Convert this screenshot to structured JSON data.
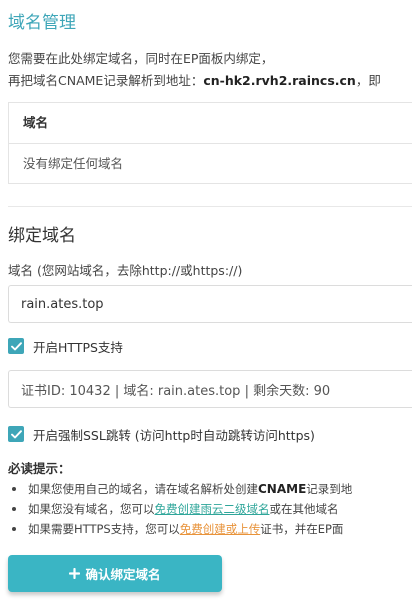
{
  "header": {
    "title": "域名管理",
    "desc_line1": "您需要在此处绑定域名，同时在EP面板内绑定，",
    "desc_line2_prefix": "再把域名CNAME记录解析到地址：",
    "cname_address": "cn-hk2.rvh2.raincs.cn",
    "desc_line2_suffix": "，即"
  },
  "domain_table": {
    "header": "域名",
    "empty_text": "没有绑定任何域名"
  },
  "bind": {
    "title": "绑定域名",
    "domain_label": "域名 (您网站域名，去除http://或https://)",
    "domain_value": "rain.ates.top",
    "https_label": "开启HTTPS支持",
    "https_checked": true,
    "cert_value": "证书ID: 10432 | 域名: rain.ates.top | 剩余天数: 90",
    "ssl_label": "开启强制SSL跳转 (访问http时自动跳转访问https)",
    "ssl_checked": true
  },
  "tips": {
    "title": "必读提示：",
    "tip1_prefix": "如果您使用自己的域名，请在域名解析处创建",
    "tip1_bold": "CNAME",
    "tip1_suffix": "记录到地",
    "tip2_prefix": "如果您没有域名，您可以",
    "tip2_link": "免费创建雨云二级域名",
    "tip2_suffix": "或在其他域名",
    "tip3_prefix": "如果需要HTTPS支持，您可以",
    "tip3_link": "免费创建或上传",
    "tip3_suffix": "证书，并在EP面"
  },
  "confirm_button": {
    "label": "确认绑定域名"
  },
  "colors": {
    "accent": "#3ea6b8",
    "button": "#3ab5c4",
    "link_green": "#2fa69a",
    "link_orange": "#e8933a"
  },
  "icons": {
    "checkbox": "checkmark-icon",
    "button": "plus-icon"
  }
}
